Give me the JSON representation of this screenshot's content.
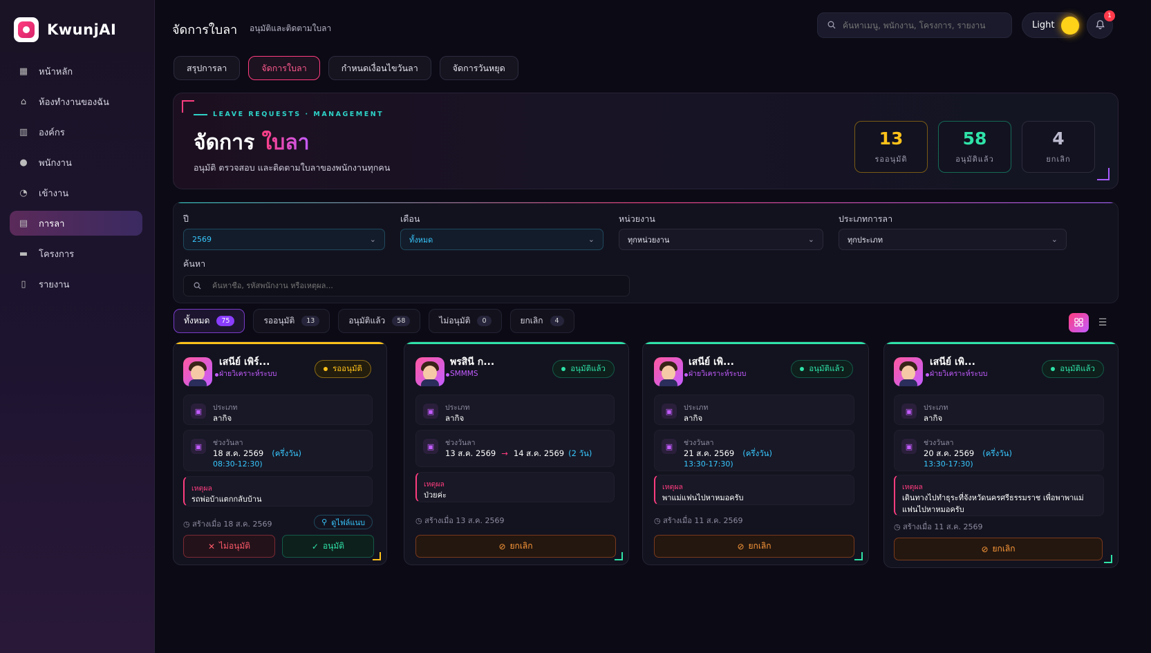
{
  "app": {
    "name": "KwunjAI"
  },
  "nav": [
    {
      "label": "หน้าหลัก",
      "icon": "dashboard-icon"
    },
    {
      "label": "ห้องทำงานของฉัน",
      "icon": "home-icon"
    },
    {
      "label": "องค์กร",
      "icon": "building-icon"
    },
    {
      "label": "พนักงาน",
      "icon": "user-icon"
    },
    {
      "label": "เข้างาน",
      "icon": "clock-icon"
    },
    {
      "label": "การลา",
      "icon": "document-icon",
      "active": true
    },
    {
      "label": "โครงการ",
      "icon": "folder-icon"
    },
    {
      "label": "รายงาน",
      "icon": "report-icon"
    }
  ],
  "header": {
    "title": "จัดการใบลา",
    "subtitle": "อนุมัติและติดตามใบลา",
    "search_placeholder": "ค้นหาเมนู, พนักงาน, โครงการ, รายงาน",
    "theme_label": "Light",
    "notification_count": "1"
  },
  "tabs": [
    "สรุปการลา",
    "จัดการใบลา",
    "กำหนดเงื่อนไขวันลา",
    "จัดการวันหยุด"
  ],
  "hero": {
    "eyebrow": "LEAVE REQUESTS · MANAGEMENT",
    "title_a": "จัดการ ",
    "title_b": "ใบลา",
    "description": "อนุมัติ ตรวจสอบ และติดตามใบลาของพนักงานทุกคน",
    "stats": [
      {
        "value": "13",
        "label": "รออนุมัติ"
      },
      {
        "value": "58",
        "label": "อนุมัติแล้ว"
      },
      {
        "value": "4",
        "label": "ยกเลิก"
      }
    ]
  },
  "filters": {
    "year_label": "ปี",
    "year_value": "2569",
    "month_label": "เดือน",
    "month_value": "ทั้งหมด",
    "unit_label": "หน่วยงาน",
    "unit_value": "ทุกหน่วยงาน",
    "type_label": "ประเภทการลา",
    "type_value": "ทุกประเภท",
    "search_label": "ค้นหา",
    "search_placeholder": "ค้นหาชื่อ, รหัสพนักงาน หรือเหตุผล..."
  },
  "status_tabs": [
    {
      "label": "ทั้งหมด",
      "count": "75"
    },
    {
      "label": "รออนุมัติ",
      "count": "13"
    },
    {
      "label": "อนุมัติแล้ว",
      "count": "58"
    },
    {
      "label": "ไม่อนุมัติ",
      "count": "0"
    },
    {
      "label": "ยกเลิก",
      "count": "4"
    }
  ],
  "labels": {
    "type": "ประเภท",
    "range": "ช่วงวันลา",
    "reason": "เหตุผล",
    "attachment": "ดูไฟล์แนบ",
    "reject": "ไม่อนุมัติ",
    "approve": "อนุมัติ",
    "cancel": "ยกเลิก"
  },
  "cards": [
    {
      "name": "เสนีย์ เพิร์...",
      "dept": "ฝ่ายวิเคราะห์ระบบ",
      "status": "รออนุมัติ",
      "type": "ลากิจ",
      "date": "18 ส.ค. 2569",
      "half": "(ครึ่งวัน)",
      "time": "08:30-12:30)",
      "reason": "รถพ่อบ้าแตกกลับบ้าน",
      "created": "สร้างเมื่อ 18 ส.ค. 2569",
      "accent": "#ffc21a"
    },
    {
      "name": "พรสินี ก...",
      "dept": "SMMMS",
      "status": "อนุมัติแล้ว",
      "type": "ลากิจ",
      "date_from": "13 ส.ค. 2569",
      "date_to": "14 ส.ค. 2569",
      "days": "(2 วัน)",
      "reason": "ป่วยค่ะ",
      "created": "สร้างเมื่อ 13 ส.ค. 2569",
      "accent": "#2fe3a8"
    },
    {
      "name": "เสนีย์ เพิ...",
      "dept": "ฝ่ายวิเคราะห์ระบบ",
      "status": "อนุมัติแล้ว",
      "type": "ลากิจ",
      "date": "21 ส.ค. 2569",
      "half": "(ครึ่งวัน)",
      "time": "13:30-17:30)",
      "reason": "พาแม่แฟนไปหาหมอครับ",
      "created": "สร้างเมื่อ 11 ส.ค. 2569",
      "accent": "#2fe3a8"
    },
    {
      "name": "เสนีย์ เพิ...",
      "dept": "ฝ่ายวิเคราะห์ระบบ",
      "status": "อนุมัติแล้ว",
      "type": "ลากิจ",
      "date": "20 ส.ค. 2569",
      "half": "(ครึ่งวัน)",
      "time": "13:30-17:30)",
      "reason": "เดินทางไปทำธุระที่จังหวัดนครศรีธรรมราช เพื่อพาพาแม่แฟนไปหาหมอครับ",
      "created": "สร้างเมื่อ 11 ส.ค. 2569",
      "accent": "#2fe3a8"
    }
  ]
}
